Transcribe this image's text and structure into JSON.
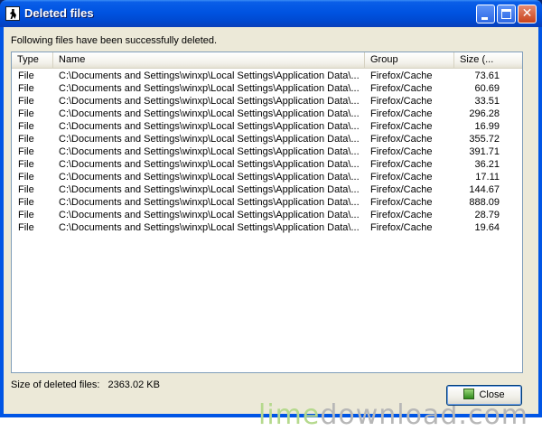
{
  "window": {
    "title": "Deleted files"
  },
  "message": "Following files have been successfully deleted.",
  "list": {
    "columns": [
      "Type",
      "Name",
      "Group",
      "Size (..."
    ],
    "rows": [
      {
        "type": "File",
        "name": "C:\\Documents and Settings\\winxp\\Local Settings\\Application Data\\...",
        "group": "Firefox/Cache",
        "size": "73.61"
      },
      {
        "type": "File",
        "name": "C:\\Documents and Settings\\winxp\\Local Settings\\Application Data\\...",
        "group": "Firefox/Cache",
        "size": "60.69"
      },
      {
        "type": "File",
        "name": "C:\\Documents and Settings\\winxp\\Local Settings\\Application Data\\...",
        "group": "Firefox/Cache",
        "size": "33.51"
      },
      {
        "type": "File",
        "name": "C:\\Documents and Settings\\winxp\\Local Settings\\Application Data\\...",
        "group": "Firefox/Cache",
        "size": "296.28"
      },
      {
        "type": "File",
        "name": "C:\\Documents and Settings\\winxp\\Local Settings\\Application Data\\...",
        "group": "Firefox/Cache",
        "size": "16.99"
      },
      {
        "type": "File",
        "name": "C:\\Documents and Settings\\winxp\\Local Settings\\Application Data\\...",
        "group": "Firefox/Cache",
        "size": "355.72"
      },
      {
        "type": "File",
        "name": "C:\\Documents and Settings\\winxp\\Local Settings\\Application Data\\...",
        "group": "Firefox/Cache",
        "size": "391.71"
      },
      {
        "type": "File",
        "name": "C:\\Documents and Settings\\winxp\\Local Settings\\Application Data\\...",
        "group": "Firefox/Cache",
        "size": "36.21"
      },
      {
        "type": "File",
        "name": "C:\\Documents and Settings\\winxp\\Local Settings\\Application Data\\...",
        "group": "Firefox/Cache",
        "size": "17.11"
      },
      {
        "type": "File",
        "name": "C:\\Documents and Settings\\winxp\\Local Settings\\Application Data\\...",
        "group": "Firefox/Cache",
        "size": "144.67"
      },
      {
        "type": "File",
        "name": "C:\\Documents and Settings\\winxp\\Local Settings\\Application Data\\...",
        "group": "Firefox/Cache",
        "size": "888.09"
      },
      {
        "type": "File",
        "name": "C:\\Documents and Settings\\winxp\\Local Settings\\Application Data\\...",
        "group": "Firefox/Cache",
        "size": "28.79"
      },
      {
        "type": "File",
        "name": "C:\\Documents and Settings\\winxp\\Local Settings\\Application Data\\...",
        "group": "Firefox/Cache",
        "size": "19.64"
      }
    ]
  },
  "footer": {
    "size_label": "Size of deleted files:",
    "size_value": "2363.02 KB",
    "close_label": "Close"
  },
  "watermark": {
    "part1": "lime",
    "part2": "download.com"
  },
  "icons": {
    "app": "person-icon",
    "close_button": "close-button-icon"
  },
  "colors": {
    "titlebar": "#0053e1",
    "close_titlebar_button": "#c9431c",
    "window_bg": "#ece9d8"
  }
}
